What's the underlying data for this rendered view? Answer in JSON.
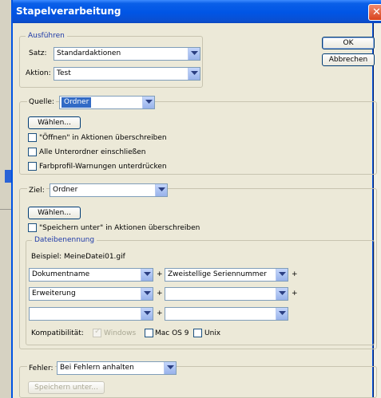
{
  "window": {
    "title": "Stapelverarbeitung",
    "close_glyph": "✕"
  },
  "buttons": {
    "ok": "OK",
    "cancel": "Abbrechen"
  },
  "ausfuehren": {
    "legend": "Ausführen",
    "satz_label": "Satz:",
    "satz_value": "Standardaktionen",
    "aktion_label": "Aktion:",
    "aktion_value": "Test"
  },
  "quelle": {
    "label": "Quelle:",
    "value": "Ordner",
    "choose": "Wählen...",
    "options": [
      {
        "label": "\"Öffnen\" in Aktionen überschreiben",
        "checked": false
      },
      {
        "label": "Alle Unterordner einschließen",
        "checked": false
      },
      {
        "label": "Farbprofil-Warnungen unterdrücken",
        "checked": false
      }
    ]
  },
  "ziel": {
    "label": "Ziel:",
    "value": "Ordner",
    "choose": "Wählen...",
    "override": {
      "label": "\"Speichern unter\" in Aktionen überschreiben",
      "checked": false
    },
    "naming": {
      "legend": "Dateibenennung",
      "example": "Beispiel: MeineDatei01.gif",
      "fields": [
        "Dokumentname",
        "Zweistellige Seriennummer",
        "Erweiterung",
        "",
        "",
        ""
      ],
      "plus": "+",
      "compat_label": "Kompatibilität:",
      "compat": [
        {
          "label": "Windows",
          "checked": true,
          "disabled": true
        },
        {
          "label": "Mac OS 9",
          "checked": false,
          "disabled": false
        },
        {
          "label": "Unix",
          "checked": false,
          "disabled": false
        }
      ]
    }
  },
  "fehler": {
    "label": "Fehler:",
    "value": "Bei Fehlern anhalten",
    "save_as": "Speichern unter..."
  }
}
